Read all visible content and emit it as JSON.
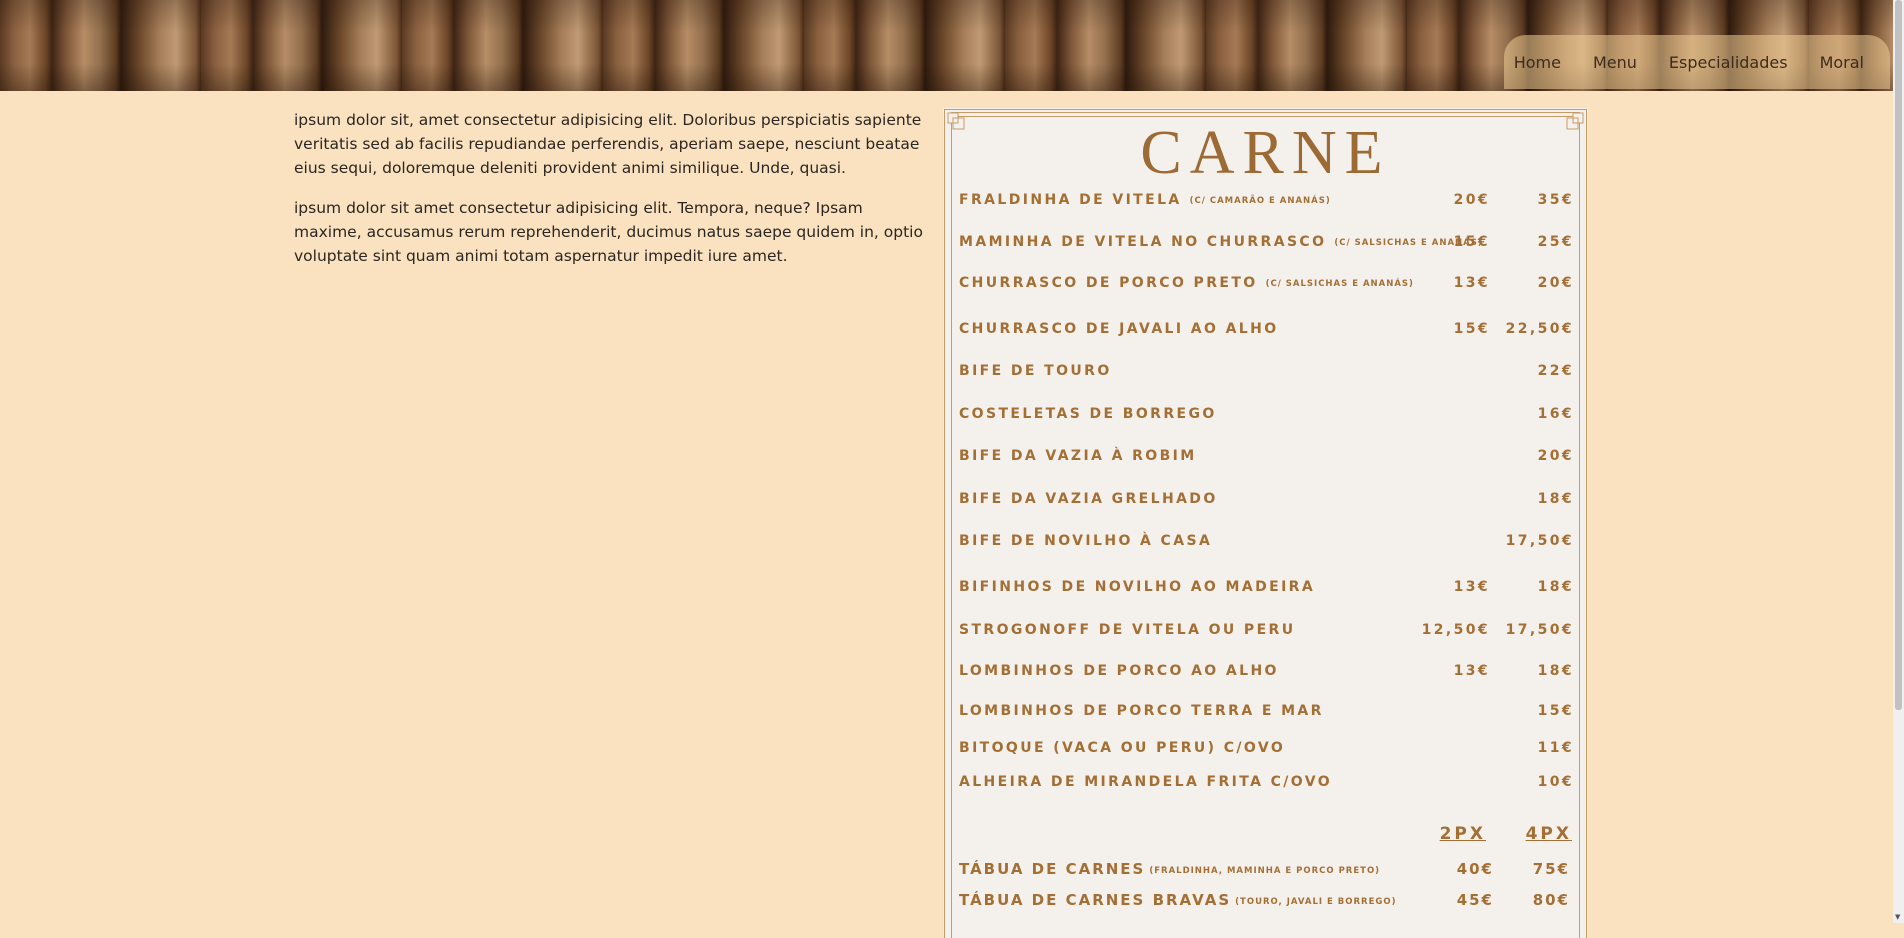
{
  "nav": {
    "items": [
      "Home",
      "Menu",
      "Especialidades",
      "Moral"
    ]
  },
  "intro": {
    "paragraphs": [
      "ipsum dolor sit, amet consectetur adipisicing elit. Doloribus perspiciatis sapiente veritatis sed ab facilis repudiandae perferendis, aperiam saepe, nesciunt beatae eius sequi, doloremque deleniti provident animi similique. Unde, quasi.",
      "ipsum dolor sit amet consectetur adipisicing elit. Tempora, neque? Ipsam maxime, accusamus rerum reprehenderit, ducimus natus saepe quidem in, optio voluptate sint quam animi totam aspernatur impedit iure amet."
    ]
  },
  "menu": {
    "title": "CARNE",
    "items": [
      {
        "name": "FRALDINHA DE VITELA",
        "note": "(C/ CAMARÃO E ANANÁS)",
        "price1": "20€",
        "price2": "35€"
      },
      {
        "name": "MAMINHA DE VITELA NO CHURRASCO",
        "note": "(C/ SALSICHAS E ANANÁS)",
        "price1": "15€",
        "price2": "25€"
      },
      {
        "name": "CHURRASCO DE PORCO PRETO",
        "note": "(C/ SALSICHAS E ANANÁS)",
        "price1": "13€",
        "price2": "20€"
      },
      {
        "name": "CHURRASCO DE JAVALI AO ALHO",
        "note": "",
        "price1": "15€",
        "price2": "22,50€"
      },
      {
        "name": "BIFE DE TOURO",
        "note": "",
        "price1": "",
        "price2": "22€"
      },
      {
        "name": "COSTELETAS DE BORREGO",
        "note": "",
        "price1": "",
        "price2": "16€"
      },
      {
        "name": "BIFE DA VAZIA À ROBIM",
        "note": "",
        "price1": "",
        "price2": "20€"
      },
      {
        "name": "BIFE DA VAZIA GRELHADO",
        "note": "",
        "price1": "",
        "price2": "18€"
      },
      {
        "name": "BIFE DE NOVILHO À CASA",
        "note": "",
        "price1": "",
        "price2": "17,50€"
      },
      {
        "name": "BIFINHOS DE NOVILHO AO MADEIRA",
        "note": "",
        "price1": "13€",
        "price2": "18€"
      },
      {
        "name": "STROGONOFF DE VITELA OU PERU",
        "note": "",
        "price1": "12,50€",
        "price2": "17,50€"
      },
      {
        "name": "LOMBINHOS DE PORCO AO ALHO",
        "note": "",
        "price1": "13€",
        "price2": "18€"
      },
      {
        "name": "LOMBINHOS DE PORCO TERRA E MAR",
        "note": "",
        "price1": "",
        "price2": "15€"
      },
      {
        "name": "BITOQUE (VACA OU PERU) C/OVO",
        "note": "",
        "price1": "",
        "price2": "11€"
      },
      {
        "name": "ALHEIRA DE MIRANDELA FRITA C/OVO",
        "note": "",
        "price1": "",
        "price2": "10€"
      }
    ],
    "platters_header": {
      "col1": "2PX",
      "col2": "4PX"
    },
    "platters": [
      {
        "name": "TÁBUA DE CARNES",
        "note": "(FRALDINHA, MAMINHA E PORCO PRETO)",
        "price1": "40€",
        "price2": "75€"
      },
      {
        "name": "TÁBUA DE CARNES BRAVAS",
        "note": "(TOURO, JAVALI E BORREGO)",
        "price1": "45€",
        "price2": "80€"
      }
    ]
  }
}
